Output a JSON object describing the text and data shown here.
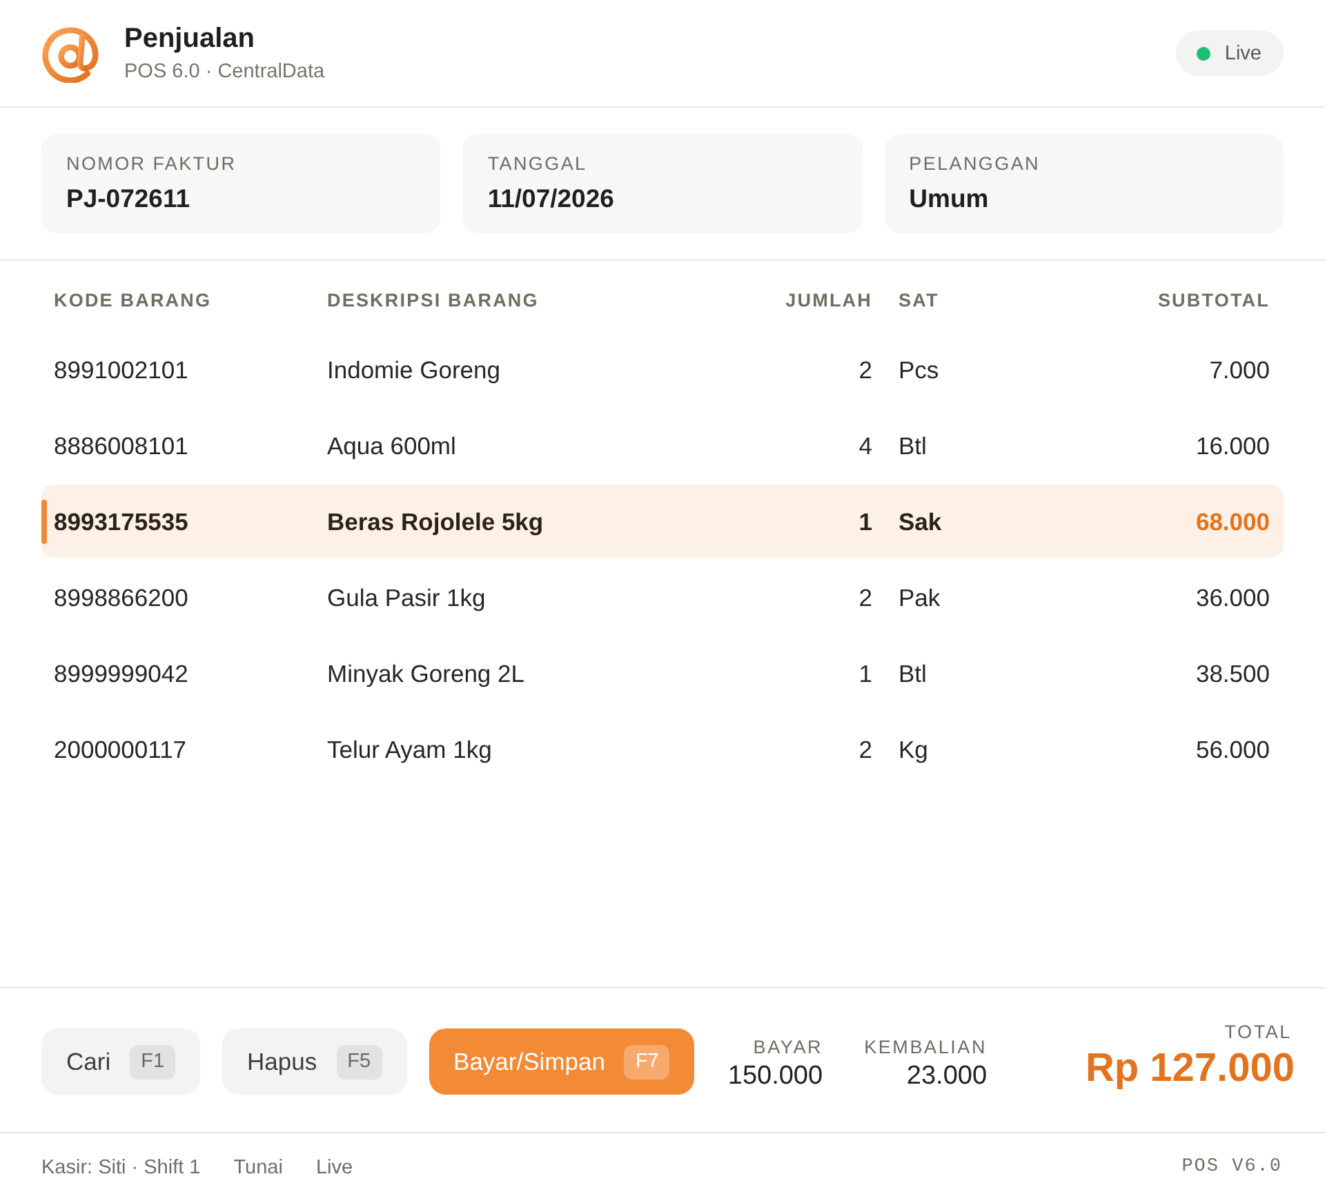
{
  "header": {
    "title": "Penjualan",
    "subtitle": "POS 6.0 · CentralData",
    "badge": {
      "label": "Live"
    }
  },
  "fields": [
    {
      "label": "NOMOR FAKTUR",
      "value": "PJ-072611"
    },
    {
      "label": "TANGGAL",
      "value": "11/07/2026"
    },
    {
      "label": "PELANGGAN",
      "value": "Umum"
    }
  ],
  "table": {
    "columns": [
      "KODE BARANG",
      "DESKRIPSI BARANG",
      "JUMLAH",
      "SAT",
      "SUBTOTAL"
    ],
    "rows": [
      {
        "code": "8991002101",
        "description": "Indomie Goreng",
        "qty": "2",
        "unit": "Pcs",
        "subtotal": "7.000",
        "selected": false
      },
      {
        "code": "8886008101",
        "description": "Aqua 600ml",
        "qty": "4",
        "unit": "Btl",
        "subtotal": "16.000",
        "selected": false
      },
      {
        "code": "8993175535",
        "description": "Beras Rojolele 5kg",
        "qty": "1",
        "unit": "Sak",
        "subtotal": "68.000",
        "selected": true
      },
      {
        "code": "8998866200",
        "description": "Gula Pasir 1kg",
        "qty": "2",
        "unit": "Pak",
        "subtotal": "36.000",
        "selected": false
      },
      {
        "code": "8999999042",
        "description": "Minyak Goreng 2L",
        "qty": "1",
        "unit": "Btl",
        "subtotal": "38.500",
        "selected": false
      },
      {
        "code": "2000000117",
        "description": "Telur Ayam 1kg",
        "qty": "2",
        "unit": "Kg",
        "subtotal": "56.000",
        "selected": false
      }
    ]
  },
  "actions": [
    {
      "label": "Cari",
      "key": "F1",
      "kind": "secondary"
    },
    {
      "label": "Hapus",
      "key": "F5",
      "kind": "secondary"
    },
    {
      "label": "Bayar/Simpan",
      "key": "F7",
      "kind": "primary"
    }
  ],
  "summary": [
    {
      "label": "BAYAR",
      "value": "150.000"
    },
    {
      "label": "KEMBALIAN",
      "value": "23.000"
    }
  ],
  "total": {
    "label": "TOTAL",
    "value": "Rp 127.000"
  },
  "status_bar": {
    "items": [
      "Kasir: Siti · Shift 1",
      "Tunai",
      "Live"
    ],
    "version": "POS V6.0"
  }
}
